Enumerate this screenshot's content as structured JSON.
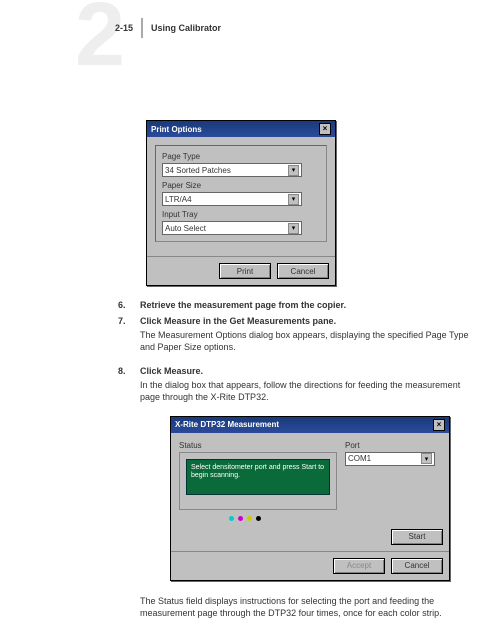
{
  "header": {
    "big_number": "2",
    "page_ref": "2-15",
    "title": "Using Calibrator"
  },
  "dlg1": {
    "title": "Print Options",
    "labels": {
      "page_type": "Page Type",
      "paper_size": "Paper Size",
      "input_tray": "Input Tray"
    },
    "values": {
      "page_type": "34 Sorted Patches",
      "paper_size": "LTR/A4",
      "input_tray": "Auto Select"
    },
    "buttons": {
      "print": "Print",
      "cancel": "Cancel"
    }
  },
  "steps": {
    "n6": "6.",
    "t6": "Retrieve the measurement page from the copier.",
    "n7": "7.",
    "t7": "Click Measure in the Get Measurements pane.",
    "p7": "The Measurement Options dialog box appears, displaying the specified Page Type and Paper Size options.",
    "n8": "8.",
    "t8": "Click Measure.",
    "p8": "In the dialog box that appears, follow the directions for feeding the measurement page through the X-Rite DTP32."
  },
  "dlg2": {
    "title": "X-Rite DTP32 Measurement",
    "labels": {
      "status": "Status",
      "port": "Port"
    },
    "status_text": "Select densitometer port and press Start to begin scanning.",
    "port_value": "COM1",
    "buttons": {
      "start": "Start",
      "accept": "Accept",
      "cancel": "Cancel"
    }
  },
  "tail": "The Status field displays instructions for selecting the port and feeding the measurement page through the DTP32 four times, once for each color strip.",
  "glyphs": {
    "close": "×",
    "down": "▾"
  }
}
